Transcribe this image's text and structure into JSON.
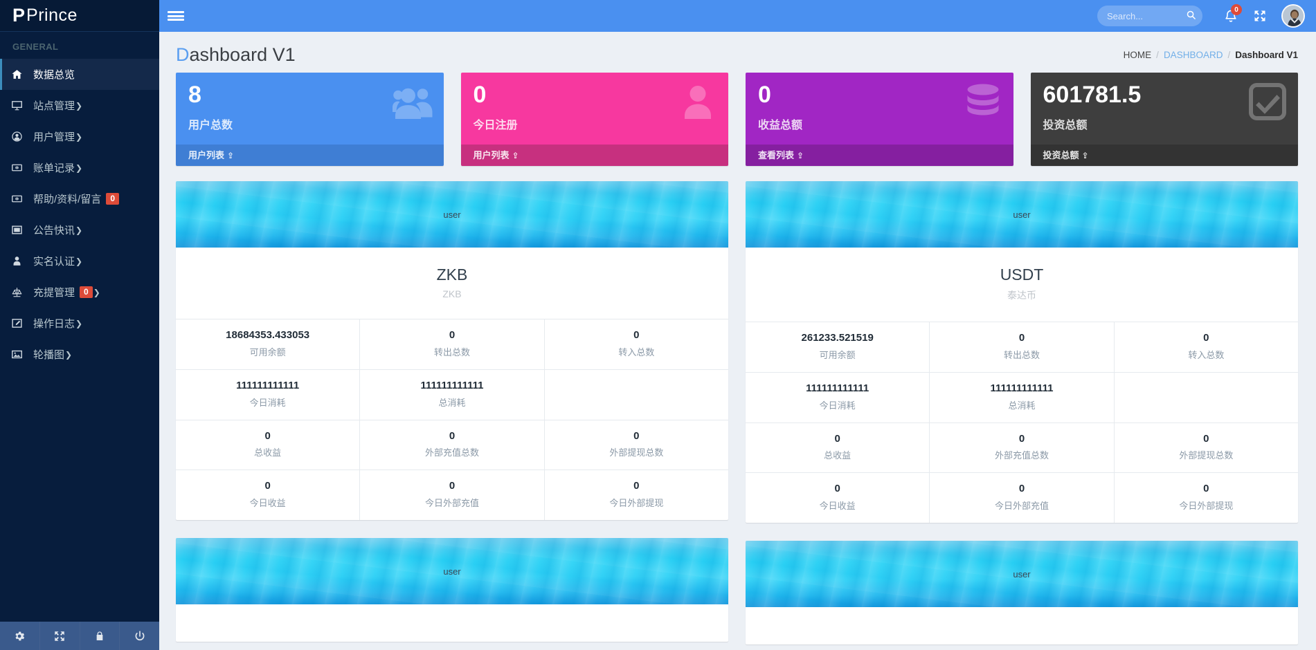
{
  "brand": {
    "logo_letter": "P",
    "name": "Prince"
  },
  "sidebar": {
    "section_header": "GENERAL",
    "items": [
      {
        "label": "数据总览",
        "icon": "home-icon",
        "caret": "",
        "badge": "",
        "active": true
      },
      {
        "label": "站点管理",
        "icon": "monitor-icon",
        "caret": "❯",
        "badge": "",
        "active": false
      },
      {
        "label": "用户管理",
        "icon": "user-circle-icon",
        "caret": "❯",
        "badge": "",
        "active": false
      },
      {
        "label": "账单记录",
        "icon": "money-icon",
        "caret": "❯",
        "badge": "",
        "active": false
      },
      {
        "label": "帮助/资料/留言",
        "icon": "money-icon",
        "caret": "",
        "badge": "0",
        "active": false
      },
      {
        "label": "公告快讯",
        "icon": "window-icon",
        "caret": "❯",
        "badge": "",
        "active": false
      },
      {
        "label": "实名认证",
        "icon": "person-icon",
        "caret": "❯",
        "badge": "",
        "active": false
      },
      {
        "label": "充提管理",
        "icon": "balance-scale-icon",
        "caret": "❯",
        "badge": "0",
        "active": false
      },
      {
        "label": "操作日志",
        "icon": "edit-icon",
        "caret": "❯",
        "badge": "",
        "active": false
      },
      {
        "label": "轮播图",
        "icon": "image-icon",
        "caret": "❯",
        "badge": "",
        "active": false
      }
    ],
    "footer_buttons": [
      "gear-icon",
      "expand-icon",
      "lock-icon",
      "power-icon"
    ]
  },
  "header": {
    "menu_toggle": "hamburger-icon",
    "search": {
      "placeholder": "Search...",
      "value": "",
      "icon": "search-icon"
    },
    "notifications": {
      "icon": "bell-icon",
      "count": "0"
    },
    "fullscreen_icon": "expand-icon",
    "avatar": "user-avatar"
  },
  "page": {
    "title_first_letter": "D",
    "title_rest": "ashboard V1",
    "breadcrumb": [
      {
        "label": "HOME",
        "type": "plain"
      },
      {
        "label": "DASHBOARD",
        "type": "link"
      },
      {
        "label": "Dashboard V1",
        "type": "active"
      }
    ],
    "breadcrumb_separator": "/"
  },
  "stat_cards": [
    {
      "value": "8",
      "label": "用户总数",
      "footer": "用户列表",
      "icon": "users-icon",
      "bg": "#4a90f0",
      "footer_bg": "#3f7ed4"
    },
    {
      "value": "0",
      "label": "今日注册",
      "footer": "用户列表",
      "icon": "user-icon",
      "bg": "#f7389f",
      "footer_bg": "#c7307f"
    },
    {
      "value": "0",
      "label": "收益总额",
      "footer": "查看列表",
      "icon": "database-icon",
      "bg": "#a126c4",
      "footer_bg": "#851fa0"
    },
    {
      "value": "601781.5",
      "label": "投资总额",
      "footer": "投资总额",
      "icon": "check-square-icon",
      "bg": "#3e3e3e",
      "footer_bg": "#333333"
    }
  ],
  "panels": [
    {
      "banner_alt": "user",
      "title": "ZKB",
      "subtitle": "ZKB",
      "rows": [
        [
          {
            "value": "18684353.433053",
            "label": "可用余额"
          },
          {
            "value": "0",
            "label": "转出总数"
          },
          {
            "value": "0",
            "label": "转入总数"
          }
        ],
        [
          {
            "value": "111111111111",
            "label": "今日消耗"
          },
          {
            "value": "111111111111",
            "label": "总消耗"
          },
          {
            "value": "",
            "label": ""
          }
        ],
        [
          {
            "value": "0",
            "label": "总收益"
          },
          {
            "value": "0",
            "label": "外部充值总数"
          },
          {
            "value": "0",
            "label": "外部提现总数"
          }
        ],
        [
          {
            "value": "0",
            "label": "今日收益"
          },
          {
            "value": "0",
            "label": "今日外部充值"
          },
          {
            "value": "0",
            "label": "今日外部提现"
          }
        ]
      ]
    },
    {
      "banner_alt": "user",
      "title": "USDT",
      "subtitle": "泰达币",
      "rows": [
        [
          {
            "value": "261233.521519",
            "label": "可用余额"
          },
          {
            "value": "0",
            "label": "转出总数"
          },
          {
            "value": "0",
            "label": "转入总数"
          }
        ],
        [
          {
            "value": "111111111111",
            "label": "今日消耗"
          },
          {
            "value": "111111111111",
            "label": "总消耗"
          },
          {
            "value": "",
            "label": ""
          }
        ],
        [
          {
            "value": "0",
            "label": "总收益"
          },
          {
            "value": "0",
            "label": "外部充值总数"
          },
          {
            "value": "0",
            "label": "外部提现总数"
          }
        ],
        [
          {
            "value": "0",
            "label": "今日收益"
          },
          {
            "value": "0",
            "label": "今日外部充值"
          },
          {
            "value": "0",
            "label": "今日外部提现"
          }
        ]
      ]
    }
  ],
  "bottom_panels": [
    {
      "banner_alt": "user"
    },
    {
      "banner_alt": "user"
    }
  ]
}
